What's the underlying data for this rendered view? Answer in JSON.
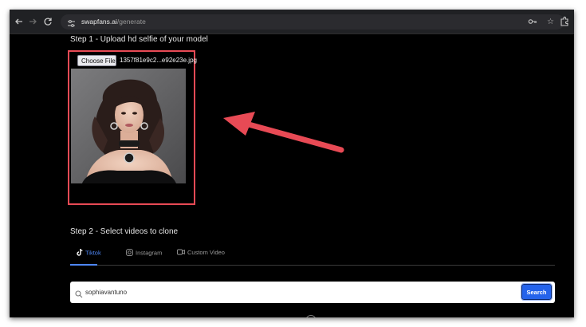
{
  "browser": {
    "url_domain": "swapfans.ai",
    "url_path": "/generate",
    "icons": [
      "back-arrow-icon",
      "forward-arrow-icon",
      "reload-icon",
      "site-settings-icon",
      "password-key-icon",
      "bookmark-star-icon",
      "extensions-icon"
    ]
  },
  "step1": {
    "title": "Step 1 - Upload hd selfie of your model",
    "choose_file_label": "Choose File",
    "file_name": "1357f81e9c2...e92e23e.jpg"
  },
  "step2": {
    "title": "Step 2 - Select videos to clone",
    "tabs": [
      {
        "label": "Tiktok",
        "icon": "tiktok-icon",
        "active": true
      },
      {
        "label": "Instagram",
        "icon": "instagram-icon",
        "active": false
      },
      {
        "label": "Custom Video",
        "icon": "video-icon",
        "active": false
      }
    ]
  },
  "search": {
    "value": "sophiavantuno",
    "button_label": "Search"
  },
  "colors": {
    "accent": "#2563eb",
    "highlight": "#e84a55",
    "background": "#000000"
  }
}
